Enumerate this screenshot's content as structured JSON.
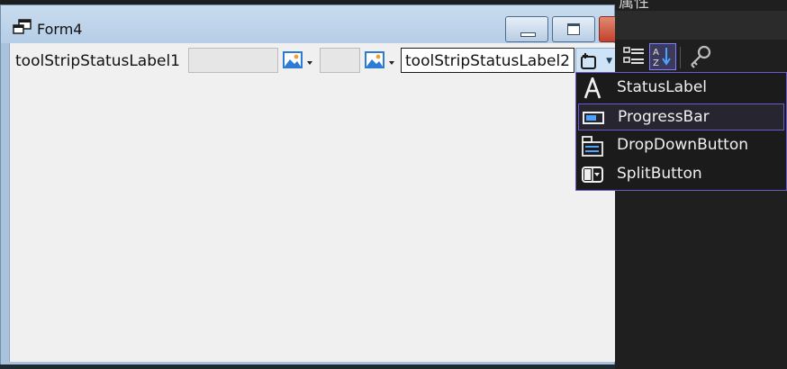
{
  "form": {
    "title": "Form4",
    "status_label_1": "toolStripStatusLabel1",
    "status_label_2": "toolStripStatusLabel2"
  },
  "properties_panel": {
    "title": "属性"
  },
  "add_item_menu": {
    "items": [
      {
        "label": "StatusLabel",
        "icon": "status-label-icon"
      },
      {
        "label": "ProgressBar",
        "icon": "progress-bar-icon"
      },
      {
        "label": "DropDownButton",
        "icon": "dropdown-button-icon"
      },
      {
        "label": "SplitButton",
        "icon": "split-button-icon"
      }
    ],
    "highlighted_index": 1
  },
  "colors": {
    "menu_border": "#6a5acd",
    "menu_background": "#1b1b1b",
    "form_client": "#f0f0f0",
    "titlebar": "#b5cde6"
  }
}
